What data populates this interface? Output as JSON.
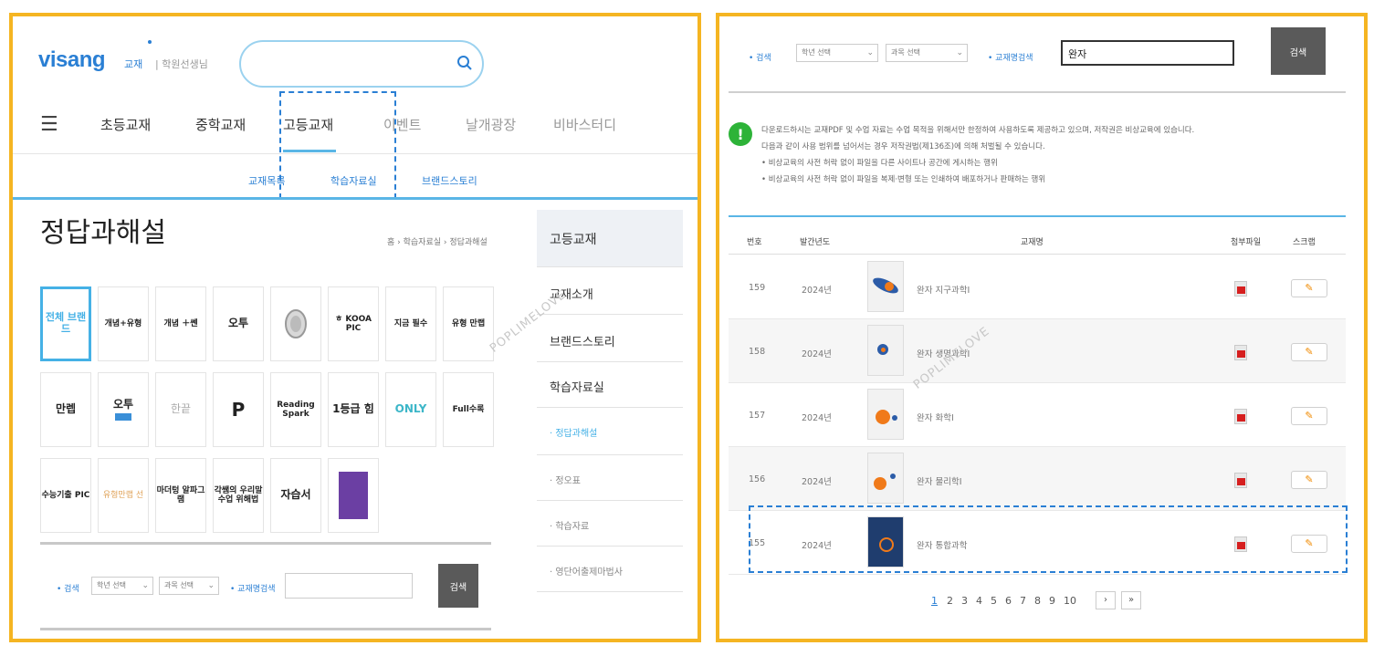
{
  "colors": {
    "frame": "#f5b522",
    "accent": "#45b1e6",
    "brand_blue": "#2a7fd4",
    "dashed_highlight": "#2a7fd4",
    "notice_green": "#2db338",
    "pdf_red": "#d61f1f"
  },
  "watermark": "POPLIMELOVE",
  "left": {
    "header": {
      "logo": "visang",
      "logo_sub_category": "교재",
      "logo_sub_separator": "|",
      "logo_sub_site": "학원선생님",
      "search_placeholder": ""
    },
    "nav": {
      "menu_icon": "hamburger-icon",
      "items": [
        "초등교재",
        "중학교재",
        "고등교재",
        "이벤트",
        "날개광장",
        "비바스터디"
      ]
    },
    "subnav": [
      "교재목록",
      "학습자료실",
      "브랜드스토리"
    ],
    "page_title": "정답과해설",
    "breadcrumb": "홈 › 학습자료실 › 정답과해설",
    "brands": [
      {
        "label": "전체 브랜드"
      },
      {
        "label": "개념+유형"
      },
      {
        "label": "개념 ＋쎈"
      },
      {
        "label": "오투"
      },
      {
        "label": ""
      },
      {
        "label": "ㅎ KOOA PIC"
      },
      {
        "label": "지금 필수"
      },
      {
        "label": "유형 만랩"
      },
      {
        "label": "만렙"
      },
      {
        "label": "오투"
      },
      {
        "label": "한끝"
      },
      {
        "label": "P"
      },
      {
        "label": "Reading Spark"
      },
      {
        "label": "1등급 힘"
      },
      {
        "label": "ONLY"
      },
      {
        "label": "Full수록"
      },
      {
        "label": "수능기출 PIC"
      },
      {
        "label": "유형만랩 선"
      },
      {
        "label": "마더텅 알파그램"
      },
      {
        "label": "각쌤의 우리말 수업 위해법"
      },
      {
        "label": "자습서"
      },
      {
        "label": ""
      }
    ],
    "sidebar": {
      "heading": "고등교재",
      "items": [
        "교재소개",
        "브랜드스토리",
        "학습자료실"
      ],
      "sub_items": [
        "· 정답과해설",
        "· 정오표",
        "· 학습자료",
        "· 영단어출제마법사"
      ]
    },
    "search_bar": {
      "label_search": "• 검색",
      "grade_select": "학년 선택",
      "subject_select": "과목 선택",
      "label_title_search": "• 교재명검색",
      "title_value": "",
      "button": "검색"
    }
  },
  "right": {
    "search_bar": {
      "label_search": "• 검색",
      "grade_select": "학년 선택",
      "subject_select": "과목 선택",
      "label_title_search": "• 교재명검색",
      "title_value": "완자",
      "button": "검색"
    },
    "notice": {
      "icon": "exclamation-icon",
      "lines": [
        "다운로드하시는 교재PDF 및 수업 자료는 수업 목적을 위해서만 한정하여 사용하도록 제공하고 있으며, 저작권은 비상교육에 있습니다.",
        "다음과 같이 사용 범위를 넘어서는 경우 저작권법(제136조)에 의해 처벌될 수 있습니다.",
        "• 비상교육의 사전 허락 없이 파일을 다른 사이트나 공간에 게시하는 행위",
        "• 비상교육의 사전 허락 없이 파일을 복제·변형 또는 인쇄하여 배포하거나 판매하는 행위"
      ]
    },
    "table": {
      "headers": [
        "번호",
        "발간년도",
        "교재명",
        "첨부파일",
        "스크랩"
      ],
      "rows": [
        {
          "no": "159",
          "year": "2024년",
          "title": "완자 지구과학Ⅰ"
        },
        {
          "no": "158",
          "year": "2024년",
          "title": "완자 생명과학Ⅰ"
        },
        {
          "no": "157",
          "year": "2024년",
          "title": "완자 화학Ⅰ"
        },
        {
          "no": "156",
          "year": "2024년",
          "title": "완자 물리학Ⅰ"
        },
        {
          "no": "155",
          "year": "2024년",
          "title": "완자 통합과학"
        }
      ]
    },
    "pagination": {
      "pages": [
        "1",
        "2",
        "3",
        "4",
        "5",
        "6",
        "7",
        "8",
        "9",
        "10"
      ],
      "current": "1",
      "next": "›",
      "last": "»"
    }
  }
}
